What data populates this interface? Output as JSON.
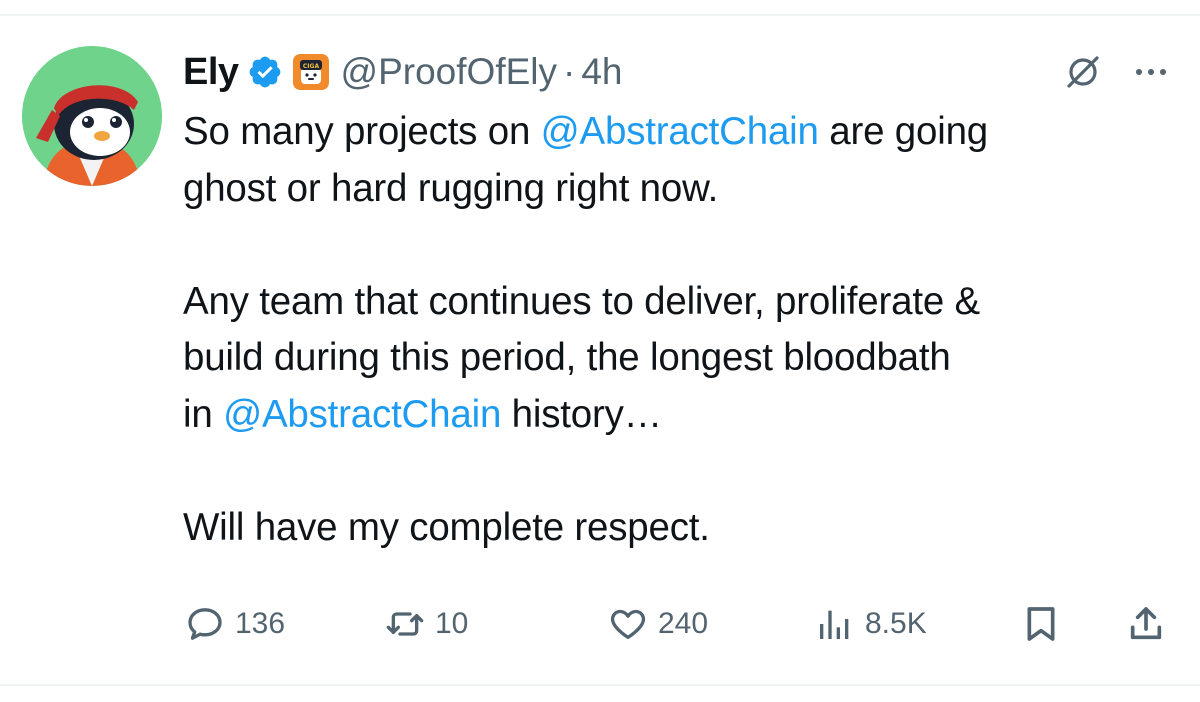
{
  "tweet": {
    "author": {
      "display_name": "Ely",
      "handle": "@ProofOfEly",
      "avatar": "penguin-avatar",
      "verified": true,
      "affiliate_badge": "CIGA",
      "avatar_bg": "#6fd38c"
    },
    "separator": "·",
    "time": "4h",
    "lines": [
      [
        {
          "t": "So many projects on "
        },
        {
          "t": "@AbstractChain",
          "m": true
        },
        {
          "t": " are going"
        }
      ],
      [
        {
          "t": "ghost or hard rugging right now."
        }
      ],
      [],
      [
        {
          "t": "Any team that continues to deliver, proliferate &"
        }
      ],
      [
        {
          "t": "build during this period, the longest bloodbath"
        }
      ],
      [
        {
          "t": "in "
        },
        {
          "t": "@AbstractChain",
          "m": true
        },
        {
          "t": " history…"
        }
      ],
      [],
      [
        {
          "t": "Will have my complete respect."
        }
      ]
    ],
    "actions": {
      "reply_count": "136",
      "retweet_count": "10",
      "like_count": "240",
      "view_count": "8.5K"
    },
    "colors": {
      "accent": "#1d9bf0",
      "text": "#0f1419",
      "secondary": "#536471"
    },
    "icons": [
      "grok-icon",
      "more-icon",
      "reply-icon",
      "retweet-icon",
      "like-icon",
      "views-icon",
      "bookmark-icon",
      "share-icon"
    ]
  }
}
